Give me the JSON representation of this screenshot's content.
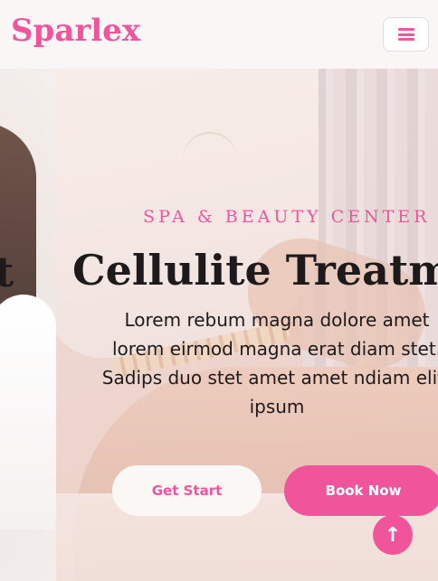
{
  "navbar": {
    "brand": "Sparlex",
    "toggle_icon": "hamburger-icon",
    "accent_color": "#f0559b"
  },
  "carousel": {
    "prev_slide_fragment": "t",
    "active_slide": {
      "subtitle": "SPA & BEAUTY CENTER",
      "title": "Cellulite Treatmen",
      "description": "Lorem rebum magna dolore amet lorem eirmod magna erat diam stet. Sadips duo stet amet amet ndiam elitr ipsum",
      "primary_button": "Get Start",
      "secondary_button": "Book Now"
    }
  },
  "back_to_top": {
    "icon": "arrow-up-icon",
    "glyph": "↑"
  }
}
